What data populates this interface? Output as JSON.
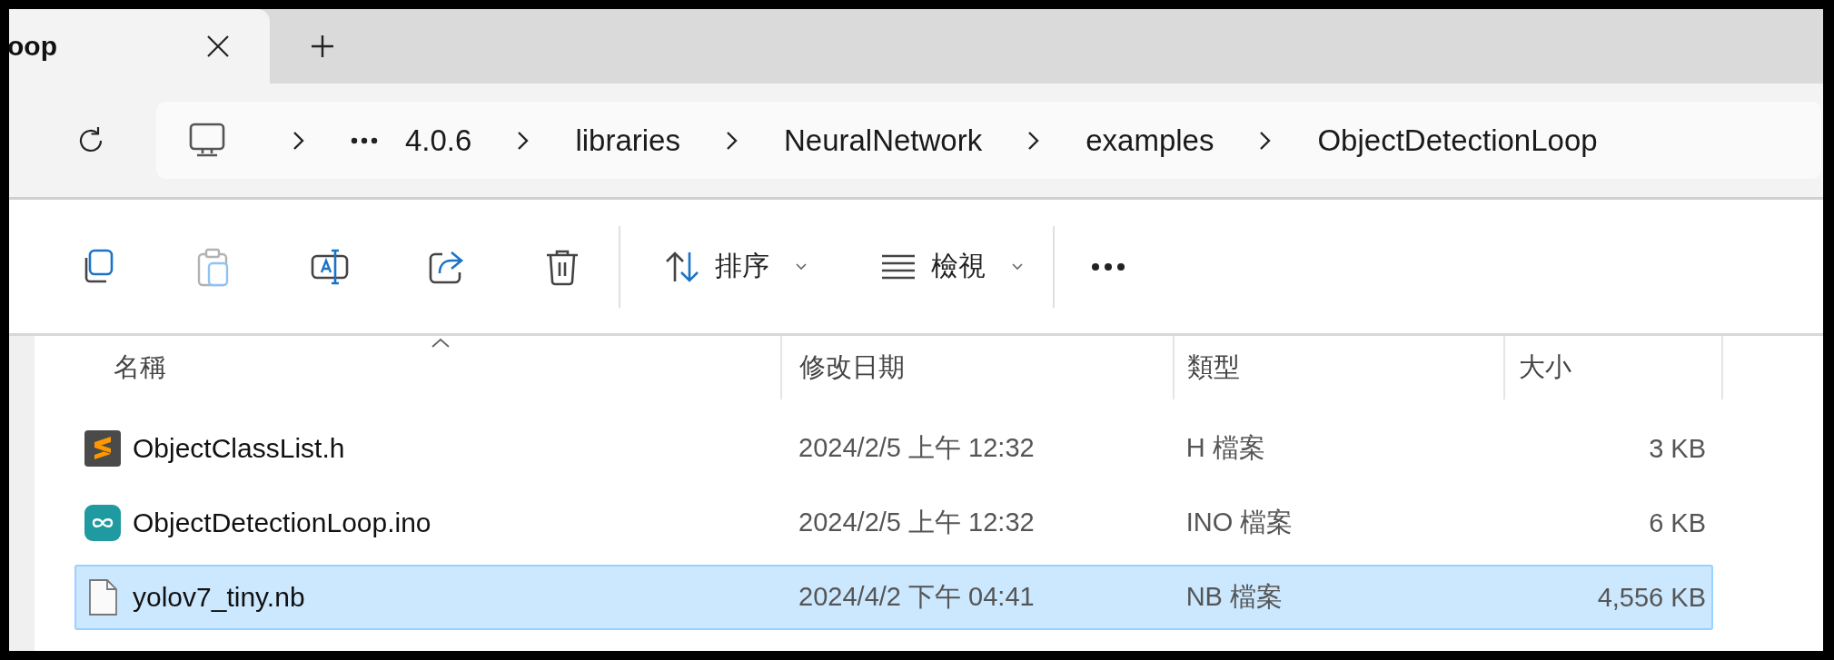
{
  "tabs": [
    {
      "title": "oop",
      "selected": true
    }
  ],
  "breadcrumb": [
    "4.0.6",
    "libraries",
    "NeuralNetwork",
    "examples",
    "ObjectDetectionLoop"
  ],
  "toolbar": {
    "buttons": [
      {
        "kind": "copy",
        "disabled": false
      },
      {
        "kind": "paste",
        "disabled": true
      },
      {
        "kind": "rename",
        "disabled": false
      },
      {
        "kind": "share",
        "disabled": false
      },
      {
        "kind": "delete",
        "disabled": false
      }
    ],
    "sort_label": "排序",
    "view_label": "檢視"
  },
  "table": {
    "columns": [
      {
        "label": "名稱",
        "sorted": true
      },
      {
        "label": "修改日期",
        "sorted": false
      },
      {
        "label": "類型",
        "sorted": false
      },
      {
        "label": "大小",
        "sorted": false
      }
    ],
    "rows": [
      {
        "kind": "sublime",
        "name": "ObjectClassList.h",
        "date": "2024/2/5 上午 12:32",
        "type": "H 檔案",
        "size": "3 KB",
        "selected": false
      },
      {
        "kind": "arduino",
        "name": "ObjectDetectionLoop.ino",
        "date": "2024/2/5 上午 12:32",
        "type": "INO 檔案",
        "size": "6 KB",
        "selected": false
      },
      {
        "kind": "file",
        "name": "yolov7_tiny.nb",
        "date": "2024/4/2 下午 04:41",
        "type": "NB 檔案",
        "size": "4,556 KB",
        "selected": true
      }
    ]
  }
}
